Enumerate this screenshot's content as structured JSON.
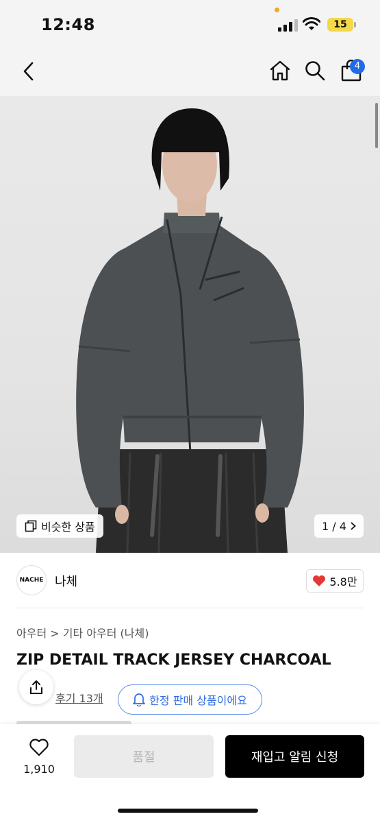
{
  "status": {
    "time": "12:48",
    "battery": "15"
  },
  "nav": {
    "cart_count": "4"
  },
  "hero": {
    "similar_label": "비슷한 상품",
    "page_indicator": "1 / 4"
  },
  "brand": {
    "logo_text": "NACHE",
    "name": "나체",
    "likes": "5.8만"
  },
  "product": {
    "breadcrumb": "아우터 > 기타 아우터 (나체)",
    "title": "ZIP DETAIL TRACK JERSEY CHARCOAL",
    "review_link": "후기 13개",
    "limited_label": "한정 판매 상품이에요"
  },
  "bottom": {
    "wish_count": "1,910",
    "soldout_label": "품절",
    "notify_label": "재입고 알림 신청"
  },
  "colors": {
    "accent_blue": "#1f6bea",
    "like_red": "#e53935",
    "primary_button": "#000000"
  }
}
